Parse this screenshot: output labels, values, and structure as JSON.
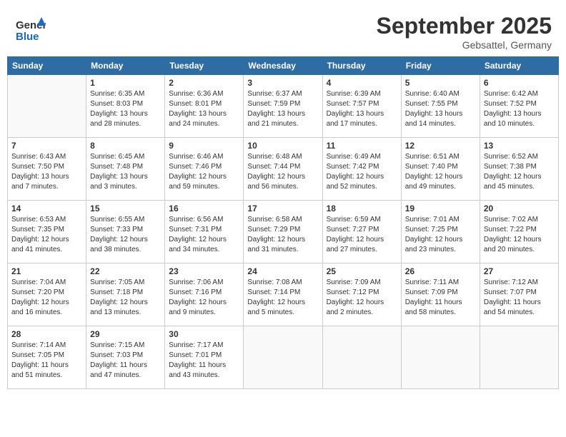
{
  "header": {
    "logo_line1": "General",
    "logo_line2": "Blue",
    "month": "September 2025",
    "location": "Gebsattel, Germany"
  },
  "days_of_week": [
    "Sunday",
    "Monday",
    "Tuesday",
    "Wednesday",
    "Thursday",
    "Friday",
    "Saturday"
  ],
  "weeks": [
    [
      {
        "day": "",
        "info": ""
      },
      {
        "day": "1",
        "info": "Sunrise: 6:35 AM\nSunset: 8:03 PM\nDaylight: 13 hours\nand 28 minutes."
      },
      {
        "day": "2",
        "info": "Sunrise: 6:36 AM\nSunset: 8:01 PM\nDaylight: 13 hours\nand 24 minutes."
      },
      {
        "day": "3",
        "info": "Sunrise: 6:37 AM\nSunset: 7:59 PM\nDaylight: 13 hours\nand 21 minutes."
      },
      {
        "day": "4",
        "info": "Sunrise: 6:39 AM\nSunset: 7:57 PM\nDaylight: 13 hours\nand 17 minutes."
      },
      {
        "day": "5",
        "info": "Sunrise: 6:40 AM\nSunset: 7:55 PM\nDaylight: 13 hours\nand 14 minutes."
      },
      {
        "day": "6",
        "info": "Sunrise: 6:42 AM\nSunset: 7:52 PM\nDaylight: 13 hours\nand 10 minutes."
      }
    ],
    [
      {
        "day": "7",
        "info": "Sunrise: 6:43 AM\nSunset: 7:50 PM\nDaylight: 13 hours\nand 7 minutes."
      },
      {
        "day": "8",
        "info": "Sunrise: 6:45 AM\nSunset: 7:48 PM\nDaylight: 13 hours\nand 3 minutes."
      },
      {
        "day": "9",
        "info": "Sunrise: 6:46 AM\nSunset: 7:46 PM\nDaylight: 12 hours\nand 59 minutes."
      },
      {
        "day": "10",
        "info": "Sunrise: 6:48 AM\nSunset: 7:44 PM\nDaylight: 12 hours\nand 56 minutes."
      },
      {
        "day": "11",
        "info": "Sunrise: 6:49 AM\nSunset: 7:42 PM\nDaylight: 12 hours\nand 52 minutes."
      },
      {
        "day": "12",
        "info": "Sunrise: 6:51 AM\nSunset: 7:40 PM\nDaylight: 12 hours\nand 49 minutes."
      },
      {
        "day": "13",
        "info": "Sunrise: 6:52 AM\nSunset: 7:38 PM\nDaylight: 12 hours\nand 45 minutes."
      }
    ],
    [
      {
        "day": "14",
        "info": "Sunrise: 6:53 AM\nSunset: 7:35 PM\nDaylight: 12 hours\nand 41 minutes."
      },
      {
        "day": "15",
        "info": "Sunrise: 6:55 AM\nSunset: 7:33 PM\nDaylight: 12 hours\nand 38 minutes."
      },
      {
        "day": "16",
        "info": "Sunrise: 6:56 AM\nSunset: 7:31 PM\nDaylight: 12 hours\nand 34 minutes."
      },
      {
        "day": "17",
        "info": "Sunrise: 6:58 AM\nSunset: 7:29 PM\nDaylight: 12 hours\nand 31 minutes."
      },
      {
        "day": "18",
        "info": "Sunrise: 6:59 AM\nSunset: 7:27 PM\nDaylight: 12 hours\nand 27 minutes."
      },
      {
        "day": "19",
        "info": "Sunrise: 7:01 AM\nSunset: 7:25 PM\nDaylight: 12 hours\nand 23 minutes."
      },
      {
        "day": "20",
        "info": "Sunrise: 7:02 AM\nSunset: 7:22 PM\nDaylight: 12 hours\nand 20 minutes."
      }
    ],
    [
      {
        "day": "21",
        "info": "Sunrise: 7:04 AM\nSunset: 7:20 PM\nDaylight: 12 hours\nand 16 minutes."
      },
      {
        "day": "22",
        "info": "Sunrise: 7:05 AM\nSunset: 7:18 PM\nDaylight: 12 hours\nand 13 minutes."
      },
      {
        "day": "23",
        "info": "Sunrise: 7:06 AM\nSunset: 7:16 PM\nDaylight: 12 hours\nand 9 minutes."
      },
      {
        "day": "24",
        "info": "Sunrise: 7:08 AM\nSunset: 7:14 PM\nDaylight: 12 hours\nand 5 minutes."
      },
      {
        "day": "25",
        "info": "Sunrise: 7:09 AM\nSunset: 7:12 PM\nDaylight: 12 hours\nand 2 minutes."
      },
      {
        "day": "26",
        "info": "Sunrise: 7:11 AM\nSunset: 7:09 PM\nDaylight: 11 hours\nand 58 minutes."
      },
      {
        "day": "27",
        "info": "Sunrise: 7:12 AM\nSunset: 7:07 PM\nDaylight: 11 hours\nand 54 minutes."
      }
    ],
    [
      {
        "day": "28",
        "info": "Sunrise: 7:14 AM\nSunset: 7:05 PM\nDaylight: 11 hours\nand 51 minutes."
      },
      {
        "day": "29",
        "info": "Sunrise: 7:15 AM\nSunset: 7:03 PM\nDaylight: 11 hours\nand 47 minutes."
      },
      {
        "day": "30",
        "info": "Sunrise: 7:17 AM\nSunset: 7:01 PM\nDaylight: 11 hours\nand 43 minutes."
      },
      {
        "day": "",
        "info": ""
      },
      {
        "day": "",
        "info": ""
      },
      {
        "day": "",
        "info": ""
      },
      {
        "day": "",
        "info": ""
      }
    ]
  ]
}
